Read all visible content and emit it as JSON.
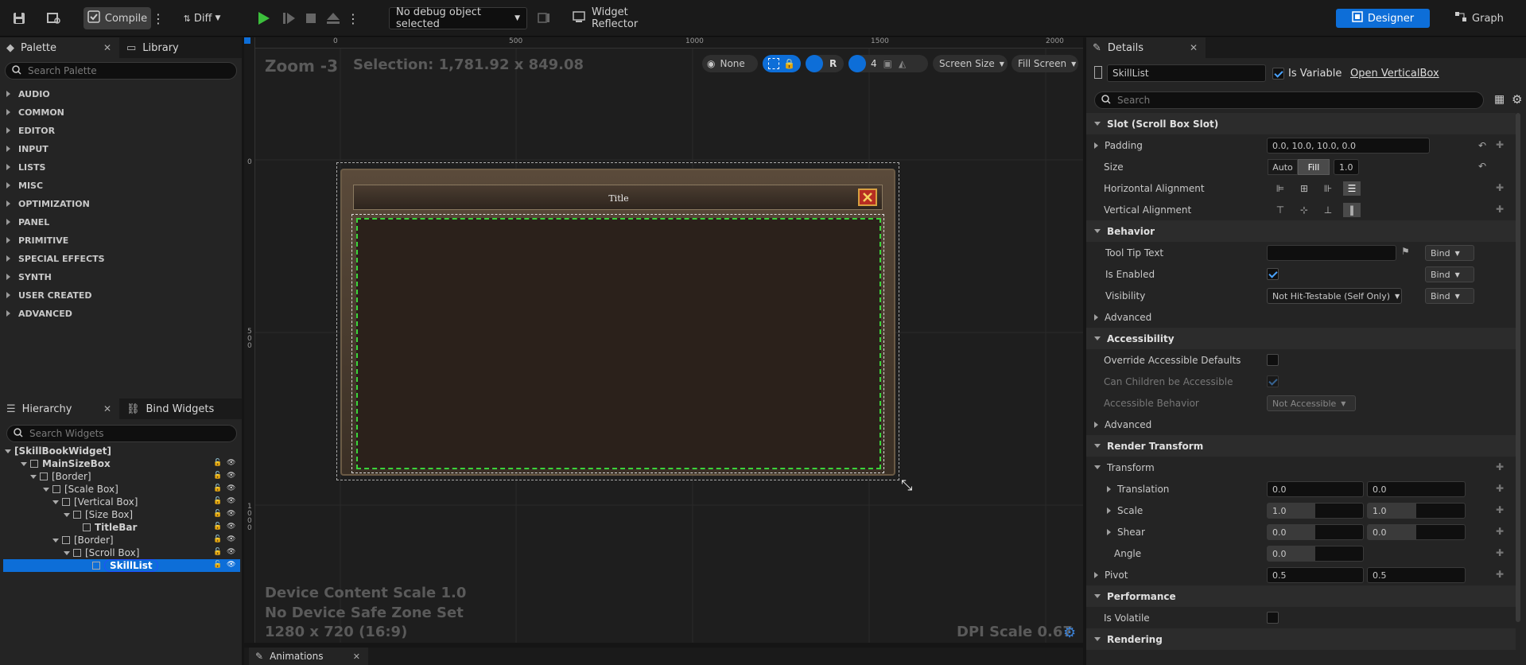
{
  "toolbar": {
    "compile_label": "Compile",
    "diff_label": "Diff",
    "debug_object": "No debug object selected",
    "widget_reflector": "Widget Reflector",
    "designer_label": "Designer",
    "graph_label": "Graph"
  },
  "palette": {
    "tab_palette": "Palette",
    "tab_library": "Library",
    "search_placeholder": "Search Palette",
    "categories": [
      "AUDIO",
      "COMMON",
      "EDITOR",
      "INPUT",
      "LISTS",
      "MISC",
      "OPTIMIZATION",
      "PANEL",
      "PRIMITIVE",
      "SPECIAL EFFECTS",
      "SYNTH",
      "USER CREATED",
      "ADVANCED"
    ]
  },
  "hierarchy": {
    "tab_hierarchy": "Hierarchy",
    "tab_bind": "Bind Widgets",
    "search_placeholder": "Search Widgets",
    "items": [
      {
        "label": "[SkillBookWidget]"
      },
      {
        "label": "MainSizeBox"
      },
      {
        "label": "[Border]"
      },
      {
        "label": "[Scale Box]"
      },
      {
        "label": "[Vertical Box]"
      },
      {
        "label": "[Size Box]"
      },
      {
        "label": "TitleBar"
      },
      {
        "label": "[Border]"
      },
      {
        "label": "[Scroll Box]"
      },
      {
        "label": "SkillList"
      }
    ]
  },
  "viewport": {
    "zoom": "Zoom -3",
    "selection": "Selection: 1,781.92 x 849.08",
    "ruler_ticks": [
      "0",
      "500",
      "1000",
      "1500",
      "2000"
    ],
    "ruler_v_ticks": [
      "0",
      "5\n0\n0",
      "1\n0\n0\n0"
    ],
    "none_label": "None",
    "r_label": "R",
    "grid_num": "4",
    "screen_size": "Screen Size",
    "fill_screen": "Fill Screen",
    "widget_title": "Title",
    "device_scale": "Device Content Scale 1.0",
    "safe_zone": "No Device Safe Zone Set",
    "resolution": "1280 x 720 (16:9)",
    "dpi": "DPI Scale 0.67"
  },
  "bottom": {
    "animations_tab": "Animations"
  },
  "details": {
    "tab": "Details",
    "name_value": "SkillList",
    "is_variable": "Is Variable",
    "open_link": "Open VerticalBox",
    "search_placeholder": "Search",
    "slot_section": "Slot (Scroll Box Slot)",
    "padding_label": "Padding",
    "padding_value": "0.0, 10.0, 10.0, 0.0",
    "size_label": "Size",
    "size_auto": "Auto",
    "size_fill": "Fill",
    "size_value": "1.0",
    "halign_label": "Horizontal Alignment",
    "valign_label": "Vertical Alignment",
    "behavior_section": "Behavior",
    "tooltip_label": "Tool Tip Text",
    "bind_label": "Bind",
    "enabled_label": "Is Enabled",
    "visibility_label": "Visibility",
    "visibility_value": "Not Hit-Testable (Self Only)",
    "advanced_label": "Advanced",
    "accessibility_section": "Accessibility",
    "override_label": "Override Accessible Defaults",
    "children_label": "Can Children be Accessible",
    "behavior_acc_label": "Accessible Behavior",
    "behavior_acc_value": "Not Accessible",
    "advanced2_label": "Advanced",
    "render_section": "Render Transform",
    "transform_label": "Transform",
    "translation_label": "Translation",
    "translation_x": "0.0",
    "translation_y": "0.0",
    "scale_label": "Scale",
    "scale_x": "1.0",
    "scale_y": "1.0",
    "shear_label": "Shear",
    "shear_x": "0.0",
    "shear_y": "0.0",
    "angle_label": "Angle",
    "angle_value": "0.0",
    "pivot_label": "Pivot",
    "pivot_x": "0.5",
    "pivot_y": "0.5",
    "performance_section": "Performance",
    "volatile_label": "Is Volatile",
    "rendering_section": "Rendering"
  },
  "colors": {
    "accent": "#0d6ed8",
    "selection_green": "#3ad43a",
    "play_green": "#3cbf3c"
  }
}
